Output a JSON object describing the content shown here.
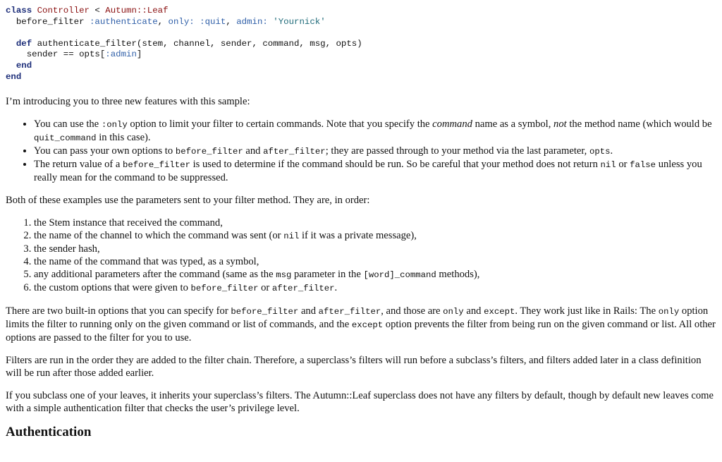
{
  "code": {
    "l1": {
      "kw_class": "class",
      "name": "Controller",
      "lt": "<",
      "parent": "Autumn::Leaf"
    },
    "l2": {
      "method": "before_filter",
      "sym_auth": ":authenticate",
      "only_key": "only:",
      "sym_quit": ":quit",
      "admin_key": "admin:",
      "admin_val": "'Yournick'"
    },
    "l4": {
      "kw_def": "def",
      "sig": "authenticate_filter(stem, channel, sender, command, msg, opts)"
    },
    "l5": {
      "text": "sender == opts[",
      "sym": ":admin",
      "close": "]"
    },
    "l6": {
      "kw_end": "end"
    },
    "l7": {
      "kw_end": "end"
    }
  },
  "intro": "I’m introducing you to three new features with this sample:",
  "features": [
    {
      "t1": "You can use the ",
      "c1": ":only",
      "t2": " option to limit your filter to certain commands. Note that you specify the ",
      "em1": "command",
      "t3": " name as a symbol, ",
      "em2": "not",
      "t4": " the method name (which would be ",
      "c2": "quit_command",
      "t5": " in this case)."
    },
    {
      "t1": "You can pass your own options to ",
      "c1": "before_filter",
      "t2": " and ",
      "c2": "after_filter",
      "t3": "; they are passed through to your method via the last parameter, ",
      "c3": "opts",
      "t4": "."
    },
    {
      "t1": "The return value of a ",
      "c1": "before_filter",
      "t2": " is used to determine if the command should be run. So be careful that your method does not return ",
      "c2": "nil",
      "t3": " or ",
      "c3": "false",
      "t4": " unless you really mean for the command to be suppressed."
    }
  ],
  "params_intro": "Both of these examples use the parameters sent to your filter method. They are, in order:",
  "params": {
    "p1": "the Stem instance that received the command,",
    "p2": {
      "t1": "the name of the channel to which the command was sent (or ",
      "c1": "nil",
      "t2": " if it was a private message),"
    },
    "p3": "the sender hash,",
    "p4": "the name of the command that was typed, as a symbol,",
    "p5": {
      "t1": "any additional parameters after the command (same as the ",
      "c1": "msg",
      "t2": " parameter in the ",
      "c2": "[word]_command",
      "t3": " methods),"
    },
    "p6": {
      "t1": "the custom options that were given to ",
      "c1": "before_filter",
      "t2": " or ",
      "c2": "after_filter",
      "t3": "."
    }
  },
  "builtin": {
    "t1": "There are two built-in options that you can specify for ",
    "c1": "before_filter",
    "t2": " and ",
    "c2": "after_filter",
    "t3": ", and those are ",
    "c3": "only",
    "t4": " and ",
    "c4": "except",
    "t5": ". They work just like in Rails: The ",
    "c5": "only",
    "t6": " option limits the filter to running only on the given command or list of commands, and the ",
    "c6": "except",
    "t7": " option prevents the filter from being run on the given command or list. All other options are passed to the filter for you to use."
  },
  "order": "Filters are run in the order they are added to the filter chain. Therefore, a superclass’s filters will run before a subclass’s filters, and filters added later in a class definition will be run after those added earlier.",
  "subclass": "If you subclass one of your leaves, it inherits your superclass’s filters. The Autumn::Leaf superclass does not have any filters by default, though by default new leaves come with a simple authentication filter that checks the user’s privilege level.",
  "heading": "Authentication"
}
